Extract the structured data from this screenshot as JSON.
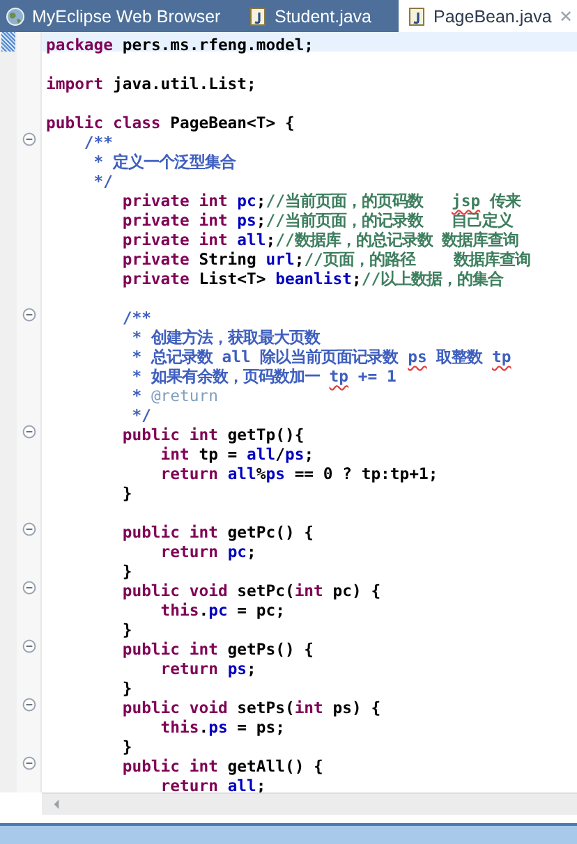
{
  "tabs": [
    {
      "label": "MyEclipse Web Browser",
      "kind": "browser",
      "selected": false
    },
    {
      "label": "Student.java",
      "kind": "java",
      "selected": false
    },
    {
      "label": "PageBean.java",
      "kind": "java",
      "selected": true,
      "close": "✕"
    }
  ],
  "lines": [
    {
      "fold": false,
      "current": true,
      "tokens": [
        {
          "t": "package",
          "kind": "kw"
        },
        {
          "t": " pers.ms.rfeng.model;",
          "kind": "plain"
        }
      ]
    },
    {
      "fold": false,
      "current": false
    },
    {
      "fold": false,
      "current": false,
      "tokens": [
        {
          "t": "import",
          "kind": "kw"
        },
        {
          "t": " java.util.List;",
          "kind": "plain"
        }
      ]
    },
    {
      "fold": false,
      "current": false
    },
    {
      "fold": false,
      "current": false,
      "tokens": [
        {
          "t": "public class",
          "kind": "kw"
        },
        {
          "t": " PageBean<T> {",
          "kind": "plain"
        }
      ]
    },
    {
      "fold": true,
      "current": false,
      "tokens": [
        {
          "t": "    /**",
          "kind": "javadoc"
        }
      ]
    },
    {
      "fold": false,
      "current": false,
      "tokens": [
        {
          "t": "     * 定义一个泛型集合",
          "kind": "javadoc"
        }
      ]
    },
    {
      "fold": false,
      "current": false,
      "tokens": [
        {
          "t": "     */",
          "kind": "javadoc"
        }
      ]
    },
    {
      "fold": false,
      "current": false,
      "tokens": [
        {
          "t": "        private int ",
          "kind": "kw"
        },
        {
          "t": "pc",
          "kind": "field"
        },
        {
          "t": ";",
          "kind": "plain"
        },
        {
          "t": "//当前页面，的页码数   ",
          "kind": "comment"
        },
        {
          "t": "jsp",
          "kind": "comment-misspelled"
        },
        {
          "t": " 传来",
          "kind": "comment"
        }
      ]
    },
    {
      "fold": false,
      "current": false,
      "tokens": [
        {
          "t": "        private int ",
          "kind": "kw"
        },
        {
          "t": "ps",
          "kind": "field"
        },
        {
          "t": ";",
          "kind": "plain"
        },
        {
          "t": "//当前页面，的记录数   自己定义",
          "kind": "comment"
        }
      ]
    },
    {
      "fold": false,
      "current": false,
      "tokens": [
        {
          "t": "        private int ",
          "kind": "kw"
        },
        {
          "t": "all",
          "kind": "field"
        },
        {
          "t": ";",
          "kind": "plain"
        },
        {
          "t": "//数据库，的总记录数 数据库查询",
          "kind": "comment"
        }
      ]
    },
    {
      "fold": false,
      "current": false,
      "tokens": [
        {
          "t": "        private",
          "kind": "kw"
        },
        {
          "t": " String ",
          "kind": "plain"
        },
        {
          "t": "url",
          "kind": "field"
        },
        {
          "t": ";",
          "kind": "plain"
        },
        {
          "t": "//页面，的路径    数据库查询",
          "kind": "comment"
        }
      ]
    },
    {
      "fold": false,
      "current": false,
      "tokens": [
        {
          "t": "        private",
          "kind": "kw"
        },
        {
          "t": " List<T> ",
          "kind": "plain"
        },
        {
          "t": "beanlist",
          "kind": "field"
        },
        {
          "t": ";",
          "kind": "plain"
        },
        {
          "t": "//以上数据，的集合",
          "kind": "comment"
        }
      ]
    },
    {
      "fold": false,
      "current": false
    },
    {
      "fold": true,
      "current": false,
      "tokens": [
        {
          "t": "        /**",
          "kind": "javadoc"
        }
      ]
    },
    {
      "fold": false,
      "current": false,
      "tokens": [
        {
          "t": "         * 创建方法，获取最大页数",
          "kind": "javadoc"
        }
      ]
    },
    {
      "fold": false,
      "current": false,
      "tokens": [
        {
          "t": "         * 总记录数 all 除以当前页面记录数 ",
          "kind": "javadoc"
        },
        {
          "t": "ps",
          "kind": "javadoc-misspelled"
        },
        {
          "t": " 取整数 ",
          "kind": "javadoc"
        },
        {
          "t": "tp",
          "kind": "javadoc-misspelled"
        }
      ]
    },
    {
      "fold": false,
      "current": false,
      "tokens": [
        {
          "t": "         * 如果有余数，页码数加一 ",
          "kind": "javadoc"
        },
        {
          "t": "tp",
          "kind": "javadoc-misspelled"
        },
        {
          "t": " += 1",
          "kind": "javadoc"
        }
      ]
    },
    {
      "fold": false,
      "current": false,
      "tokens": [
        {
          "t": "         * ",
          "kind": "javadoc"
        },
        {
          "t": "@return",
          "kind": "tag"
        }
      ]
    },
    {
      "fold": false,
      "current": false,
      "tokens": [
        {
          "t": "         */",
          "kind": "javadoc"
        }
      ]
    },
    {
      "fold": true,
      "current": false,
      "tokens": [
        {
          "t": "        public int",
          "kind": "kw"
        },
        {
          "t": " getTp(){",
          "kind": "plain"
        }
      ]
    },
    {
      "fold": false,
      "current": false,
      "tokens": [
        {
          "t": "            int",
          "kind": "kw"
        },
        {
          "t": " tp = ",
          "kind": "plain"
        },
        {
          "t": "all",
          "kind": "field"
        },
        {
          "t": "/",
          "kind": "plain"
        },
        {
          "t": "ps",
          "kind": "field"
        },
        {
          "t": ";",
          "kind": "plain"
        }
      ]
    },
    {
      "fold": false,
      "current": false,
      "tokens": [
        {
          "t": "            return ",
          "kind": "kw"
        },
        {
          "t": "all",
          "kind": "field"
        },
        {
          "t": "%",
          "kind": "plain"
        },
        {
          "t": "ps",
          "kind": "field"
        },
        {
          "t": " == 0 ? tp:tp+1;",
          "kind": "plain"
        }
      ]
    },
    {
      "fold": false,
      "current": false,
      "tokens": [
        {
          "t": "        }",
          "kind": "plain"
        }
      ]
    },
    {
      "fold": false,
      "current": false
    },
    {
      "fold": true,
      "current": false,
      "tokens": [
        {
          "t": "        public int",
          "kind": "kw"
        },
        {
          "t": " getPc() {",
          "kind": "plain"
        }
      ]
    },
    {
      "fold": false,
      "current": false,
      "tokens": [
        {
          "t": "            return ",
          "kind": "kw"
        },
        {
          "t": "pc",
          "kind": "field"
        },
        {
          "t": ";",
          "kind": "plain"
        }
      ]
    },
    {
      "fold": false,
      "current": false,
      "tokens": [
        {
          "t": "        }",
          "kind": "plain"
        }
      ]
    },
    {
      "fold": true,
      "current": false,
      "tokens": [
        {
          "t": "        public void",
          "kind": "kw"
        },
        {
          "t": " setPc(",
          "kind": "plain"
        },
        {
          "t": "int",
          "kind": "kw"
        },
        {
          "t": " pc) {",
          "kind": "plain"
        }
      ]
    },
    {
      "fold": false,
      "current": false,
      "tokens": [
        {
          "t": "            this",
          "kind": "kw"
        },
        {
          "t": ".",
          "kind": "plain"
        },
        {
          "t": "pc",
          "kind": "field"
        },
        {
          "t": " = pc;",
          "kind": "plain"
        }
      ]
    },
    {
      "fold": false,
      "current": false,
      "tokens": [
        {
          "t": "        }",
          "kind": "plain"
        }
      ]
    },
    {
      "fold": true,
      "current": false,
      "tokens": [
        {
          "t": "        public int",
          "kind": "kw"
        },
        {
          "t": " getPs() {",
          "kind": "plain"
        }
      ]
    },
    {
      "fold": false,
      "current": false,
      "tokens": [
        {
          "t": "            return ",
          "kind": "kw"
        },
        {
          "t": "ps",
          "kind": "field"
        },
        {
          "t": ";",
          "kind": "plain"
        }
      ]
    },
    {
      "fold": false,
      "current": false,
      "tokens": [
        {
          "t": "        }",
          "kind": "plain"
        }
      ]
    },
    {
      "fold": true,
      "current": false,
      "tokens": [
        {
          "t": "        public void",
          "kind": "kw"
        },
        {
          "t": " setPs(",
          "kind": "plain"
        },
        {
          "t": "int",
          "kind": "kw"
        },
        {
          "t": " ps) {",
          "kind": "plain"
        }
      ]
    },
    {
      "fold": false,
      "current": false,
      "tokens": [
        {
          "t": "            this",
          "kind": "kw"
        },
        {
          "t": ".",
          "kind": "plain"
        },
        {
          "t": "ps",
          "kind": "field"
        },
        {
          "t": " = ps;",
          "kind": "plain"
        }
      ]
    },
    {
      "fold": false,
      "current": false,
      "tokens": [
        {
          "t": "        }",
          "kind": "plain"
        }
      ]
    },
    {
      "fold": true,
      "current": false,
      "tokens": [
        {
          "t": "        public int",
          "kind": "kw"
        },
        {
          "t": " getAll() {",
          "kind": "plain"
        }
      ]
    },
    {
      "fold": false,
      "current": false,
      "tokens": [
        {
          "t": "            return ",
          "kind": "kw"
        },
        {
          "t": "all",
          "kind": "field"
        },
        {
          "t": ";",
          "kind": "plain"
        }
      ]
    }
  ]
}
